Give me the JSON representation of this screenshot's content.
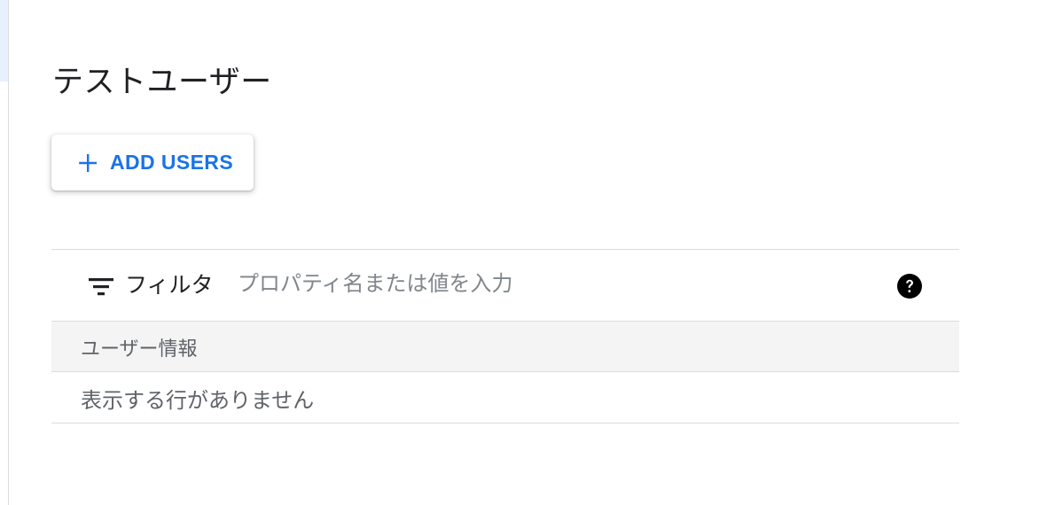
{
  "page": {
    "title": "テストユーザー"
  },
  "toolbar": {
    "add_users_label": "ADD USERS",
    "add_icon": "plus-icon"
  },
  "filter": {
    "label": "フィルタ",
    "placeholder": "プロパティ名または値を入力",
    "value": "",
    "filter_icon": "filter-list-icon",
    "help_icon": "help-icon"
  },
  "table": {
    "columns": [
      "ユーザー情報"
    ],
    "rows": [],
    "empty_message": "表示する行がありません"
  },
  "colors": {
    "accent": "#1a73e8",
    "text_primary": "#202124",
    "text_secondary": "#5f6368",
    "placeholder": "#80868b",
    "divider": "#dadce0",
    "header_background": "#f4f4f4",
    "rail_highlight": "#e8f0fe"
  }
}
